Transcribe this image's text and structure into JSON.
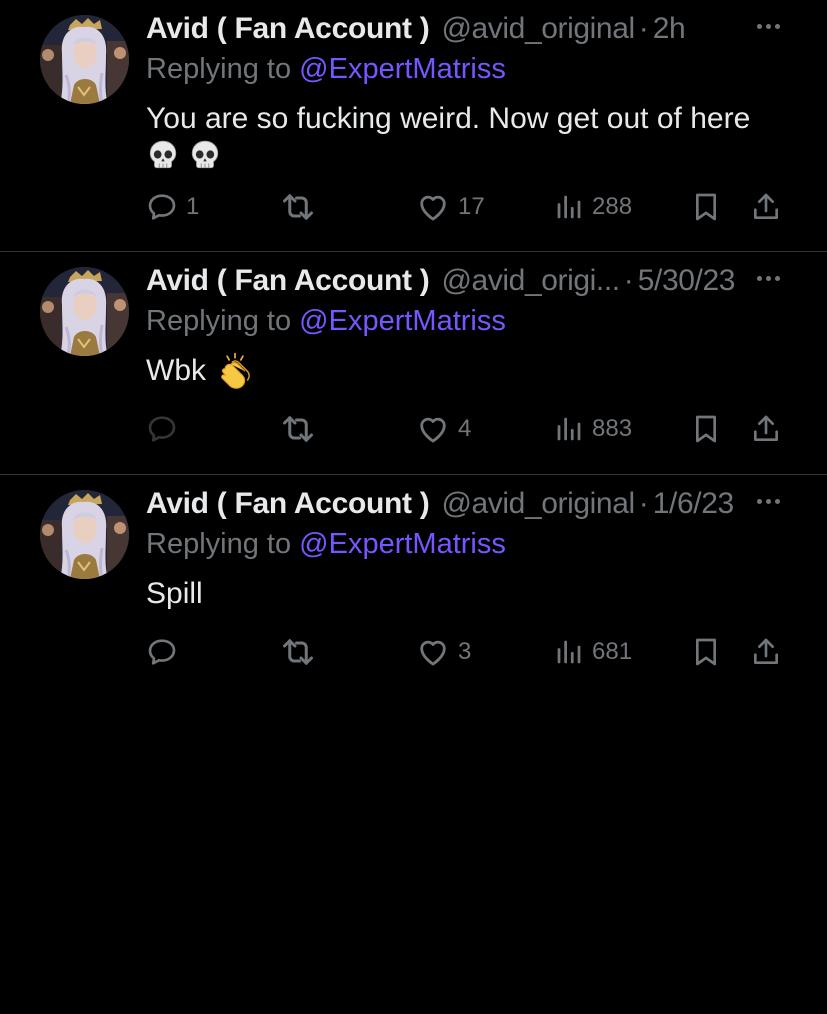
{
  "tweets": [
    {
      "name": "Avid ( Fan Account )",
      "handle": "@avid_original",
      "separator": "·",
      "time": "2h",
      "replying_prefix": "Replying to ",
      "replying_to": "@ExpertMatriss",
      "text": "You are so fucking weird. Now get out of here",
      "emojis": [
        "skull-emoji",
        "skull-emoji"
      ],
      "replies": "1",
      "retweets": "",
      "likes": "17",
      "views": "288"
    },
    {
      "name": "Avid ( Fan Account )",
      "handle": "@avid_origi...",
      "separator": "·",
      "time": "5/30/23",
      "replying_prefix": "Replying to ",
      "replying_to": "@ExpertMatriss",
      "text": "Wbk",
      "emojis": [
        "clapping-hands-emoji"
      ],
      "replies": "",
      "retweets": "",
      "likes": "4",
      "views": "883"
    },
    {
      "name": "Avid ( Fan Account )",
      "handle": "@avid_original",
      "separator": "·",
      "time": "1/6/23",
      "replying_prefix": "Replying to ",
      "replying_to": "@ExpertMatriss",
      "text": "Spill",
      "emojis": [],
      "replies": "",
      "retweets": "",
      "likes": "3",
      "views": "681"
    }
  ],
  "colors": {
    "background": "#000000",
    "text": "#e7e9ea",
    "muted": "#71767b",
    "mention": "#7856ff",
    "divider": "#2f3336"
  },
  "icons": {
    "reply": "speech-bubble-icon",
    "retweet": "retweet-arrows-icon",
    "like": "heart-outline-icon",
    "views": "bar-chart-icon",
    "bookmark": "bookmark-icon",
    "share": "share-upload-icon",
    "more": "more-horizontal-icon"
  }
}
